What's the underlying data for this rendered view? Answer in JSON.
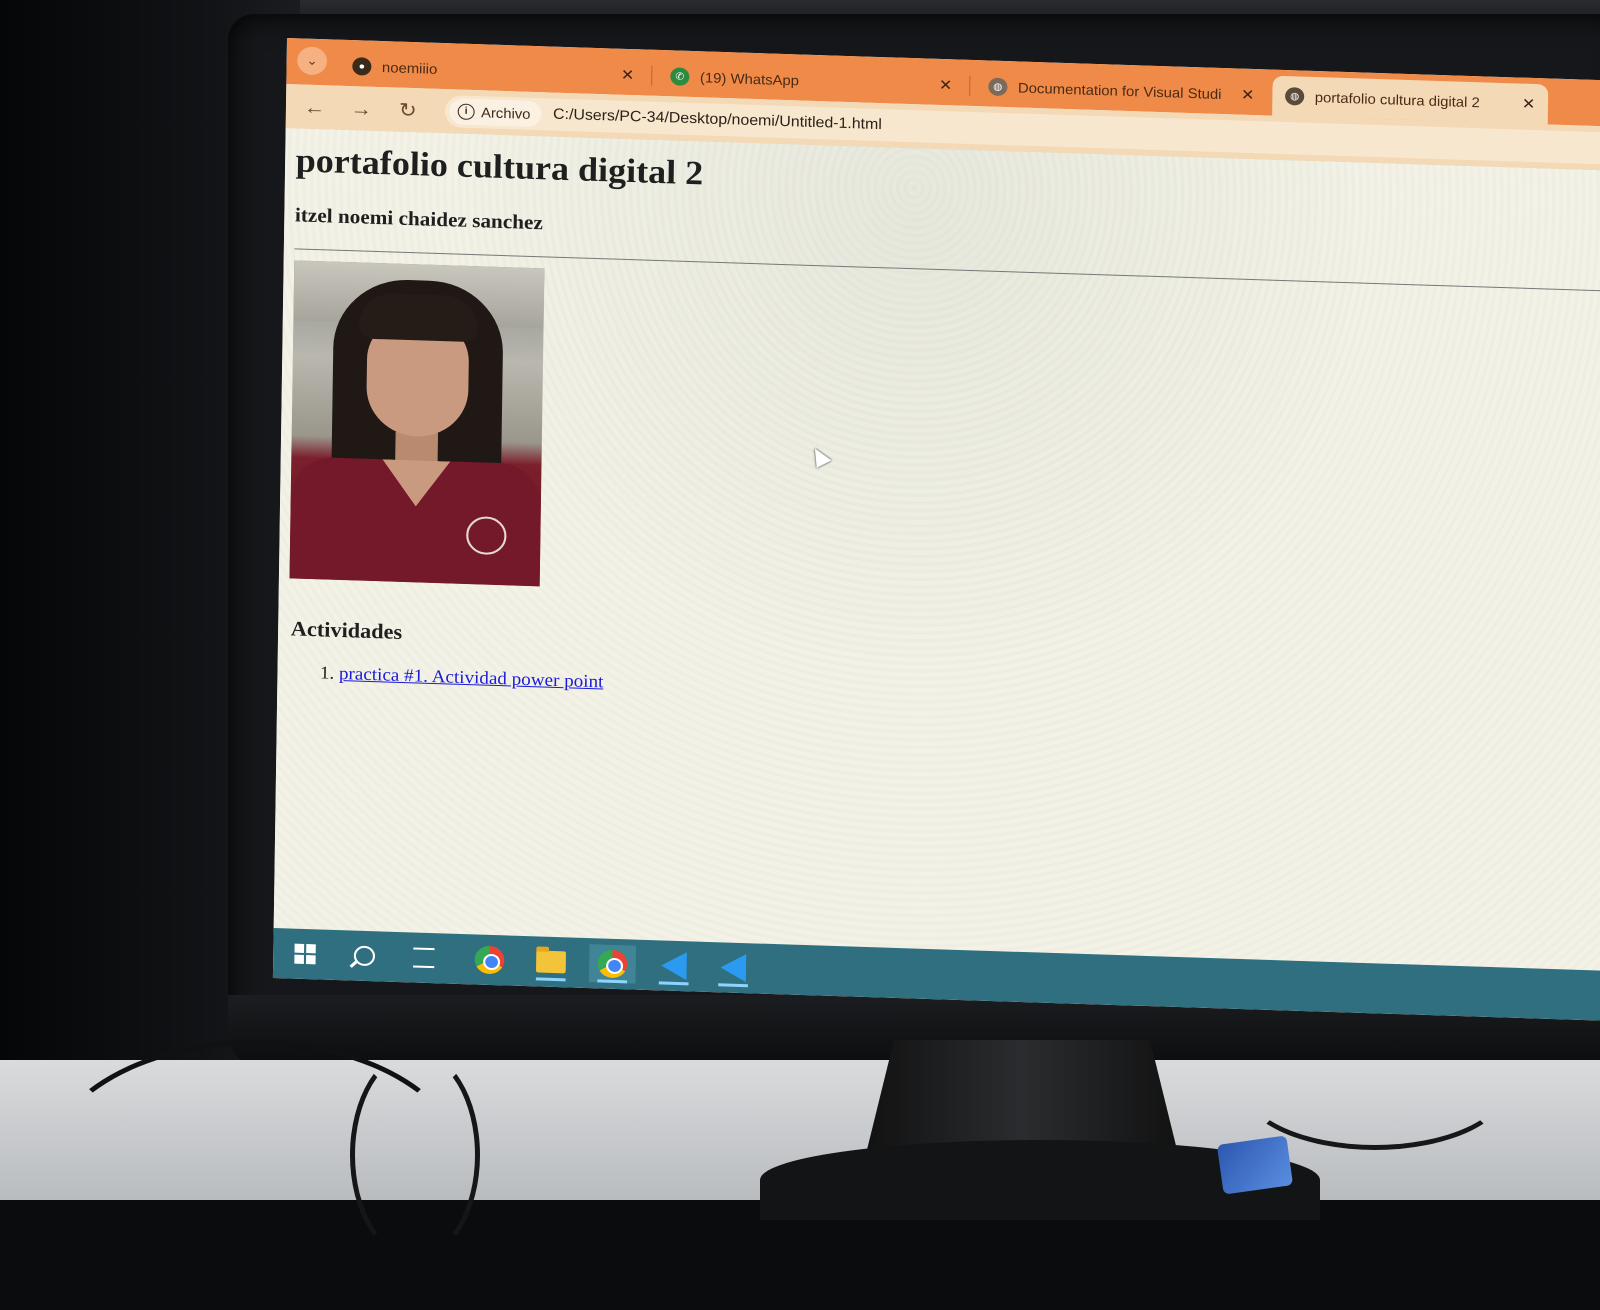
{
  "browser": {
    "tabs": [
      {
        "title": "noemiiio",
        "favicon": "github-icon",
        "active": false
      },
      {
        "title": "(19) WhatsApp",
        "favicon": "whatsapp-icon",
        "active": false
      },
      {
        "title": "Documentation for Visual Studi",
        "favicon": "globe-icon",
        "active": false
      },
      {
        "title": "portafolio cultura digital 2",
        "favicon": "globe-icon",
        "active": true
      }
    ],
    "newtab": "+",
    "site_chip": "Archivo",
    "url": "C:/Users/PC-34/Desktop/noemi/Untitled-1.html",
    "accent": "#f08a48"
  },
  "page": {
    "title": "portafolio cultura digital 2",
    "author": "itzel noemi chaidez sanchez",
    "section_title": "Actividades",
    "activities": [
      {
        "number": "1.",
        "label": "practica #1. Actividad power point"
      }
    ]
  },
  "taskbar": {
    "items": [
      "windows-start-icon",
      "search-icon",
      "task-view-icon",
      "chrome-icon",
      "file-explorer-icon",
      "chrome-profile-icon",
      "vscode-icon",
      "vscode-icon"
    ],
    "color": "#2f6f7f"
  }
}
